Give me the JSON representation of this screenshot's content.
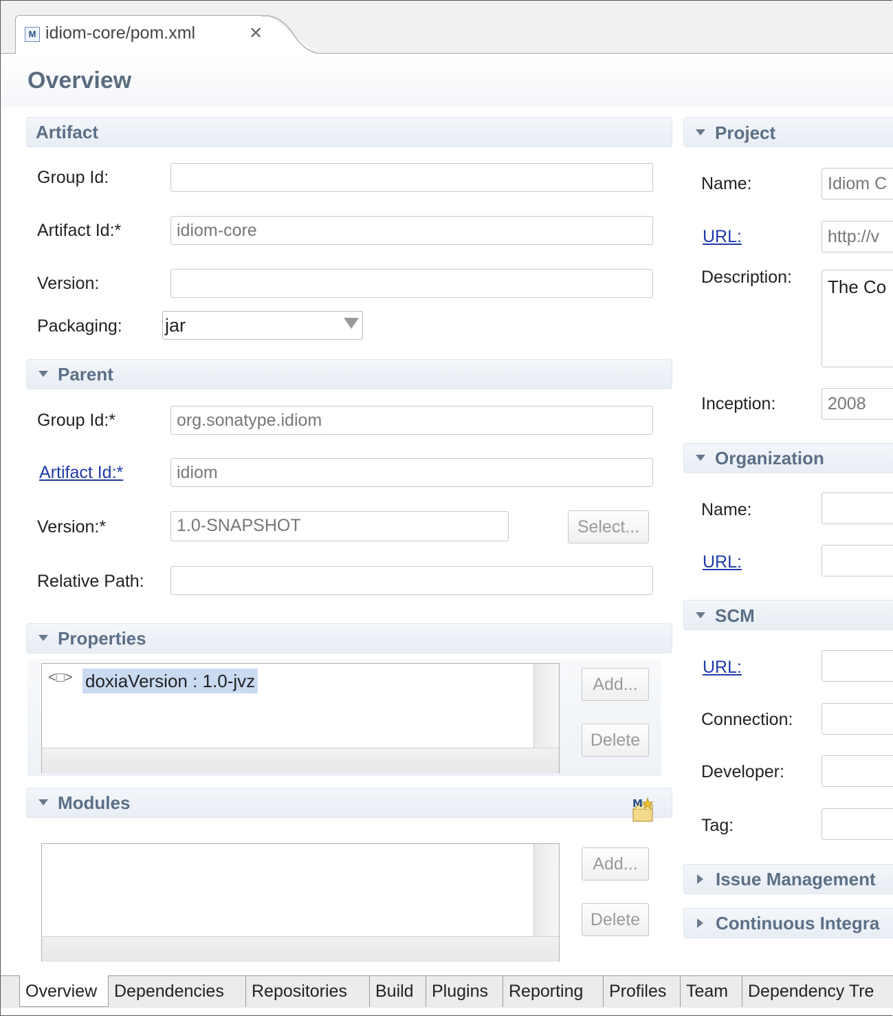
{
  "editor_tab": {
    "title": "idiom-core/pom.xml",
    "icon": "maven-pom-file-icon"
  },
  "page_title": "Overview",
  "artifact": {
    "title": "Artifact",
    "group_id_label": "Group Id:",
    "group_id_value": "",
    "artifact_id_label": "Artifact Id:*",
    "artifact_id_value": "idiom-core",
    "version_label": "Version:",
    "version_value": "",
    "packaging_label": "Packaging:",
    "packaging_value": "jar"
  },
  "parent": {
    "title": "Parent",
    "group_id_label": "Group Id:*",
    "group_id_value": "org.sonatype.idiom",
    "artifact_id_label": "Artifact Id:*",
    "artifact_id_value": "idiom",
    "version_label": "Version:*",
    "version_value": "1.0-SNAPSHOT",
    "select_label": "Select...",
    "relative_path_label": "Relative Path:",
    "relative_path_value": ""
  },
  "properties": {
    "title": "Properties",
    "items": [
      {
        "icon": "<□>",
        "text": "doxiaVersion : 1.0-jvz"
      }
    ],
    "add_label": "Add...",
    "delete_label": "Delete"
  },
  "modules": {
    "title": "Modules",
    "add_label": "Add...",
    "delete_label": "Delete",
    "icon": "create-module-icon"
  },
  "project": {
    "title": "Project",
    "name_label": "Name:",
    "name_value": "Idiom C",
    "url_label": "URL:",
    "url_value": "http://v",
    "description_label": "Description:",
    "description_value": "The Co",
    "inception_label": "Inception:",
    "inception_value": "2008"
  },
  "organization": {
    "title": "Organization",
    "name_label": "Name:",
    "url_label": "URL:"
  },
  "scm": {
    "title": "SCM",
    "url_label": "URL:",
    "connection_label": "Connection:",
    "developer_label": "Developer:",
    "tag_label": "Tag:"
  },
  "issue_management": {
    "title": "Issue Management"
  },
  "continuous_integration": {
    "title": "Continuous Integra"
  },
  "bottom_tabs": [
    "Overview",
    "Dependencies",
    "Repositories",
    "Build",
    "Plugins",
    "Reporting",
    "Profiles",
    "Team",
    "Dependency Tre"
  ],
  "colors": {
    "section_title": "#5c6f86",
    "link": "#1f3aa8",
    "selection": "#c9daf1"
  }
}
